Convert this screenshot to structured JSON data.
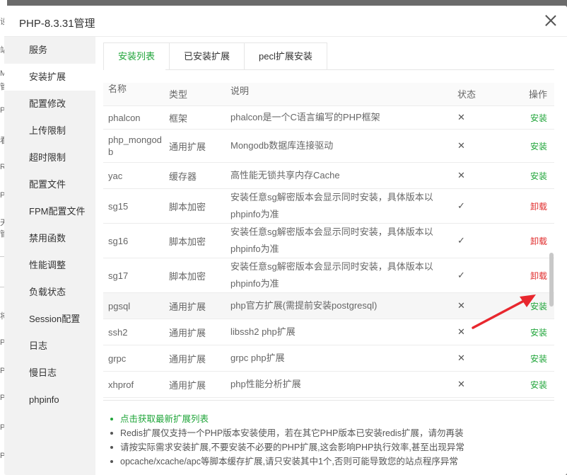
{
  "background_page": {
    "fragments": [
      "设",
      "站",
      "M",
      "管",
      "P",
      "看",
      "R",
      "P",
      "天",
      "管",
      "将",
      "P",
      "P",
      "P",
      "P",
      "P",
      "P"
    ]
  },
  "dialog": {
    "title": "PHP-8.3.31管理"
  },
  "sidebar": {
    "items": [
      {
        "label": "服务",
        "active": false
      },
      {
        "label": "安装扩展",
        "active": true
      },
      {
        "label": "配置修改",
        "active": false
      },
      {
        "label": "上传限制",
        "active": false
      },
      {
        "label": "超时限制",
        "active": false
      },
      {
        "label": "配置文件",
        "active": false
      },
      {
        "label": "FPM配置文件",
        "active": false
      },
      {
        "label": "禁用函数",
        "active": false
      },
      {
        "label": "性能调整",
        "active": false
      },
      {
        "label": "负载状态",
        "active": false
      },
      {
        "label": "Session配置",
        "active": false
      },
      {
        "label": "日志",
        "active": false
      },
      {
        "label": "慢日志",
        "active": false
      },
      {
        "label": "phpinfo",
        "active": false
      }
    ]
  },
  "tabs": [
    {
      "label": "安装列表",
      "active": true
    },
    {
      "label": "已安装扩展",
      "active": false
    },
    {
      "label": "pecl扩展安装",
      "active": false
    }
  ],
  "table": {
    "headers": [
      "名称",
      "类型",
      "说明",
      "状态",
      "操作"
    ],
    "rows": [
      {
        "name": "phalcon",
        "type": "框架",
        "desc": "phalcon是一个C语言编写的PHP框架",
        "status": "✕",
        "action": "安装",
        "installed": false
      },
      {
        "name": "php_mongodb",
        "type": "通用扩展",
        "desc": "Mongodb数据库连接驱动",
        "status": "✕",
        "action": "安装",
        "installed": false
      },
      {
        "name": "yac",
        "type": "缓存器",
        "desc": "高性能无锁共享内存Cache",
        "status": "✕",
        "action": "安装",
        "installed": false
      },
      {
        "name": "sg15",
        "type": "脚本加密",
        "desc": "安装任意sg解密版本会显示同时安装，具体版本以phpinfo为准",
        "status": "✓",
        "action": "卸载",
        "installed": true
      },
      {
        "name": "sg16",
        "type": "脚本加密",
        "desc": "安装任意sg解密版本会显示同时安装，具体版本以phpinfo为准",
        "status": "✓",
        "action": "卸载",
        "installed": true
      },
      {
        "name": "sg17",
        "type": "脚本加密",
        "desc": "安装任意sg解密版本会显示同时安装，具体版本以phpinfo为准",
        "status": "✓",
        "action": "卸载",
        "installed": true
      },
      {
        "name": "pgsql",
        "type": "通用扩展",
        "desc": "php官方扩展(需提前安装postgresql)",
        "status": "✕",
        "action": "安装",
        "installed": false
      },
      {
        "name": "ssh2",
        "type": "通用扩展",
        "desc": "libssh2 php扩展",
        "status": "✕",
        "action": "安装",
        "installed": false
      },
      {
        "name": "grpc",
        "type": "通用扩展",
        "desc": "grpc php扩展",
        "status": "✕",
        "action": "安装",
        "installed": false
      },
      {
        "name": "xhprof",
        "type": "通用扩展",
        "desc": "php性能分析扩展",
        "status": "✕",
        "action": "安装",
        "installed": false
      }
    ]
  },
  "notes": {
    "link": "点击获取最新扩展列表",
    "items": [
      "Redis扩展仅支持一个PHP版本安装使用，若在其它PHP版本已安装redis扩展，请勿再装",
      "请按实际需求安装扩展,不要安装不必要的PHP扩展,这会影响PHP执行效率,甚至出现异常",
      "opcache/xcache/apc等脚本缓存扩展,请只安装其中1个,否则可能导致您的站点程序异常"
    ]
  },
  "colors": {
    "accent_green": "#20a53a",
    "uninstall_red": "#e02d2d",
    "annotation_arrow": "#e8272e"
  },
  "icons": {
    "close": "close-icon",
    "not_installed": "x-icon",
    "installed": "check-icon"
  }
}
